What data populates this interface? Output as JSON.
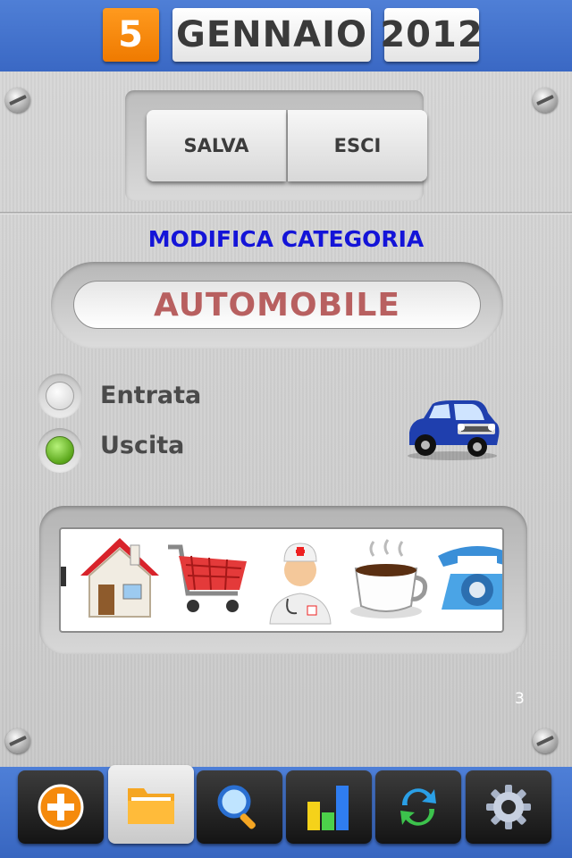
{
  "date": {
    "day": "5",
    "month": "GENNAIO",
    "year": "2012"
  },
  "toolbar": {
    "save_label": "SALVA",
    "exit_label": "ESCI"
  },
  "form": {
    "title": "MODIFICA CATEGORIA",
    "category_name": "AUTOMOBILE",
    "type_options": [
      {
        "label": "Entrata",
        "selected": false
      },
      {
        "label": "Uscita",
        "selected": true
      }
    ],
    "selected_icon": "car-icon"
  },
  "icon_picker": {
    "icons": [
      "house-icon",
      "shopping-cart-icon",
      "doctor-icon",
      "coffee-cup-icon",
      "telephone-icon"
    ]
  },
  "page_indicator": "3",
  "tabs": [
    {
      "icon": "add-icon",
      "active": false
    },
    {
      "icon": "folder-icon",
      "active": true
    },
    {
      "icon": "search-icon",
      "active": false
    },
    {
      "icon": "bar-chart-icon",
      "active": false
    },
    {
      "icon": "sync-icon",
      "active": false
    },
    {
      "icon": "settings-gear-icon",
      "active": false
    }
  ],
  "colors": {
    "bar_blue": "#4677d0",
    "accent_orange": "#f58a0c",
    "title_blue": "#1414d8",
    "category_red": "#b86060",
    "radio_green": "#5aa61a"
  }
}
